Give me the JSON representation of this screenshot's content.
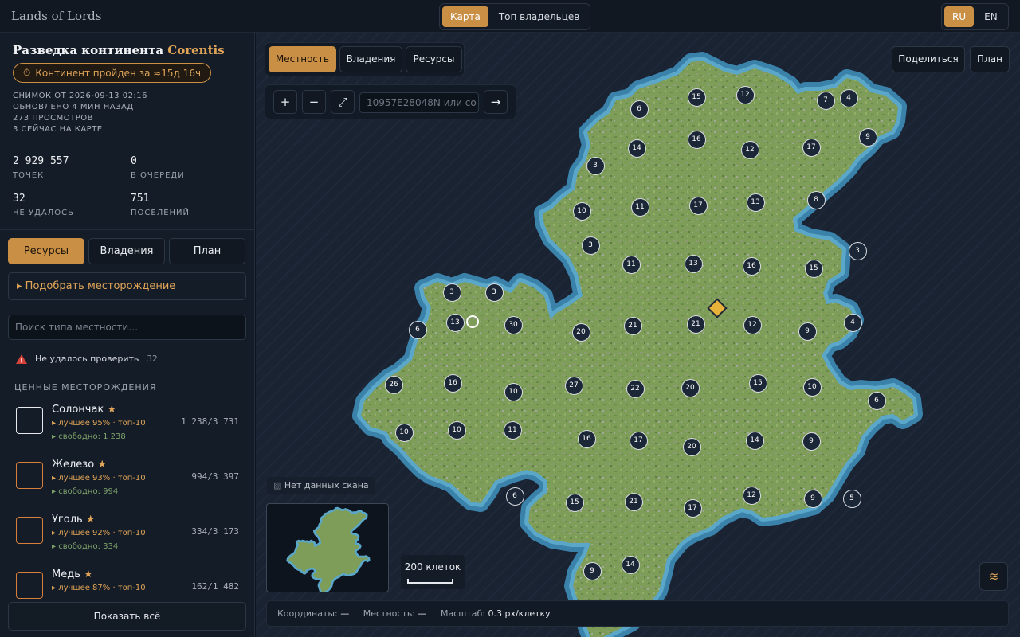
{
  "header": {
    "logo": "Lands of Lords",
    "view_tabs": [
      {
        "label": "Карта",
        "active": true
      },
      {
        "label": "Топ владельцев",
        "active": false
      }
    ],
    "langs": [
      {
        "label": "RU",
        "active": true
      },
      {
        "label": "EN",
        "active": false
      }
    ]
  },
  "sidebar": {
    "title_prefix": "Разведка континента",
    "continent": "Corentis",
    "status_pill": "Континент пройден за ≈15д 16ч",
    "meta": [
      "Снимок от 2026-09-13 02:16",
      "Обновлено 4 мин назад",
      "273 просмотров",
      "3 сейчас на карте"
    ],
    "stats": [
      {
        "value": "2 929 557",
        "label": "ТОЧЕК"
      },
      {
        "value": "0",
        "label": "В ОЧЕРЕДИ"
      },
      {
        "value": "32",
        "label": "НЕ УДАЛОСЬ"
      },
      {
        "value": "751",
        "label": "ПОСЕЛЕНИЙ"
      }
    ],
    "tabs": [
      {
        "label": "Ресурсы",
        "active": true
      },
      {
        "label": "Владения",
        "active": false
      },
      {
        "label": "План",
        "active": false
      }
    ],
    "deposit_picker": "Подобрать месторождение",
    "search_placeholder": "Поиск типа местности…",
    "warning": {
      "label": "Не удалось проверить",
      "count": "32"
    },
    "section_title": "ЦЕННЫЕ МЕСТОРОЖДЕНИЯ",
    "resources": [
      {
        "name": "Солончак",
        "best": "лучшее 95% · топ-10",
        "free": "свободно: 1 238",
        "count": "1 238/3 731",
        "color": "#e6e9ee"
      },
      {
        "name": "Железо",
        "best": "лучшее 93% · топ-10",
        "free": "свободно: 994",
        "count": "994/3 397",
        "color": "#d87f3a"
      },
      {
        "name": "Уголь",
        "best": "лучшее 92% · топ-10",
        "free": "свободно: 334",
        "count": "334/3 173",
        "color": "#d87f3a"
      },
      {
        "name": "Медь",
        "best": "лучшее 87% · топ-10",
        "free": "",
        "count": "162/1 482",
        "color": "#d87f3a"
      }
    ],
    "show_all": "Показать всё"
  },
  "map": {
    "layer_tabs": [
      {
        "label": "Местность",
        "active": true
      },
      {
        "label": "Владения",
        "active": false
      },
      {
        "label": "Ресурсы",
        "active": false
      }
    ],
    "actions": {
      "share": "Поделиться",
      "plan": "План"
    },
    "zoom_in": "+",
    "zoom_out": "−",
    "fit": "⤢",
    "go": "→",
    "coord_placeholder": "10957E28048N или co",
    "no_data": "Нет данных скана",
    "scale_label": "200 клеток",
    "layers_icon": "≋",
    "status": {
      "coords_label": "Координаты:",
      "coords_value": "—",
      "terrain_label": "Местность:",
      "terrain_value": "—",
      "scale_label": "Масштаб:",
      "scale_value": "0.3 px/клетку"
    },
    "markers": [
      "15",
      "12",
      "7",
      "4",
      "6",
      "16",
      "12",
      "17",
      "9",
      "14",
      "3",
      "8",
      "10",
      "11",
      "17",
      "13",
      "3",
      "11",
      "13",
      "16",
      "15",
      "3",
      "3",
      "3",
      "13",
      "30",
      "20",
      "21",
      "21",
      "12",
      "9",
      "4",
      "6",
      "26",
      "16",
      "10",
      "27",
      "22",
      "20",
      "15",
      "10",
      "6",
      "10",
      "10",
      "11",
      "16",
      "17",
      "20",
      "14",
      "9",
      "6",
      "15",
      "21",
      "17",
      "12",
      "9",
      "5",
      "9",
      "14"
    ]
  }
}
